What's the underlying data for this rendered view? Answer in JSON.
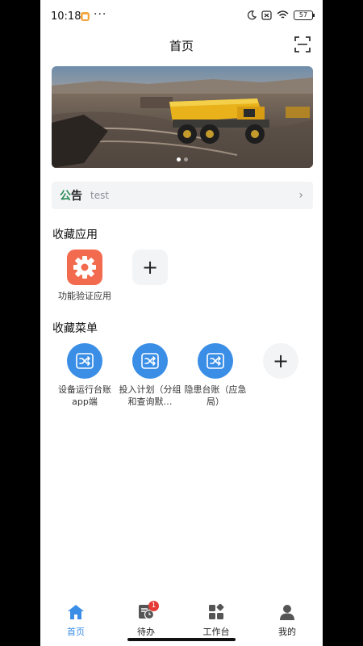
{
  "status": {
    "time": "10:18",
    "battery": "57"
  },
  "header": {
    "title": "首页"
  },
  "notice": {
    "tag_part1": "公",
    "tag_part2": "告",
    "text": "test"
  },
  "favorites_apps": {
    "title": "收藏应用",
    "items": [
      {
        "label": "功能验证应用"
      }
    ]
  },
  "favorites_menus": {
    "title": "收藏菜单",
    "items": [
      {
        "label": "设备运行台账app端"
      },
      {
        "label": "投入计划（分组和查询默…"
      },
      {
        "label": "隐患台账（应急局）"
      }
    ]
  },
  "tabbar": {
    "items": [
      {
        "label": "首页"
      },
      {
        "label": "待办",
        "badge": "1"
      },
      {
        "label": "工作台"
      },
      {
        "label": "我的"
      }
    ]
  },
  "colors": {
    "accent": "#3a8ee6",
    "app_icon": "#f36b4f",
    "badge": "#e53935"
  }
}
